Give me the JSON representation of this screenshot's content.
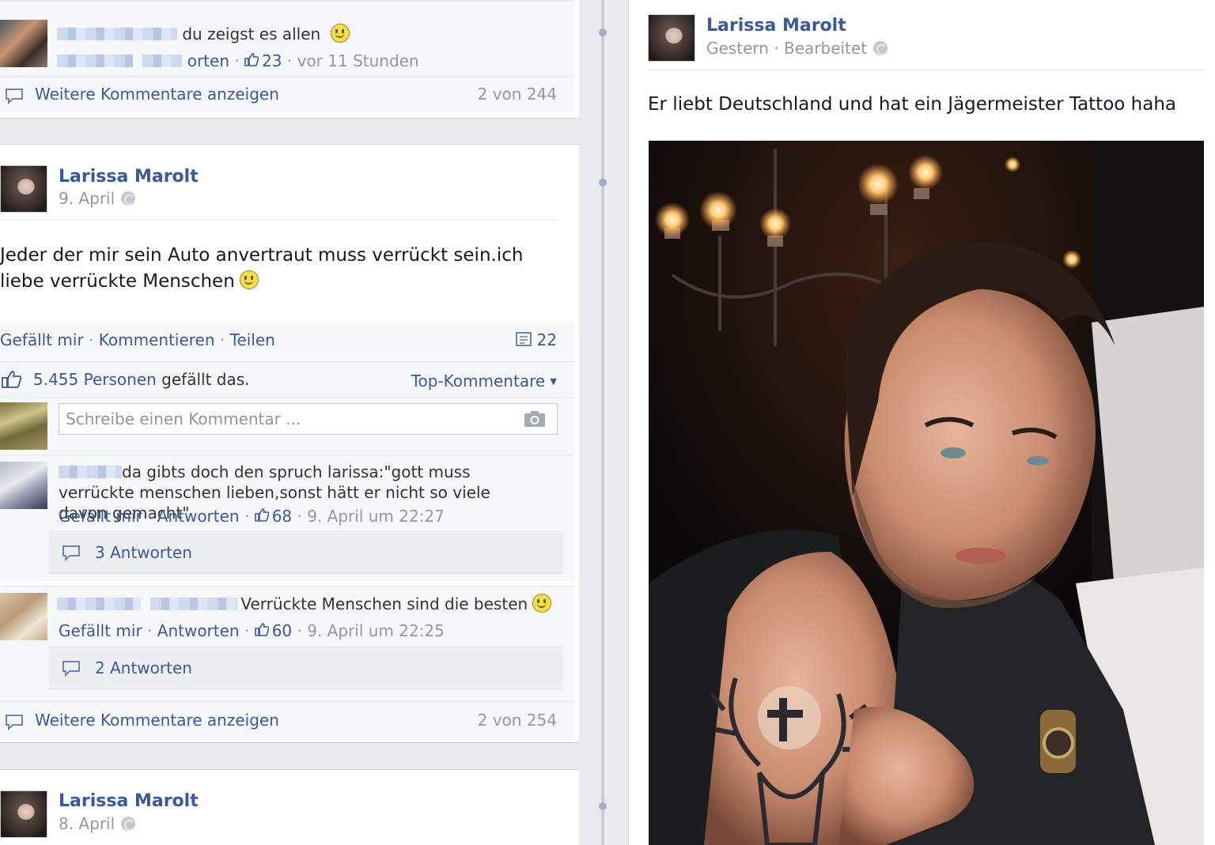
{
  "left": {
    "top_block": {
      "comment_text": "du zeigst es allen",
      "partial_action": "orten",
      "likes": "23",
      "time": "vor 11 Stunden",
      "more_comments": "Weitere Kommentare anzeigen",
      "more_count": "2 von 244"
    },
    "post": {
      "author": "Larissa Marolt",
      "date": "9. April",
      "text": "Jeder der mir sein Auto anvertraut muss verrückt sein.ich liebe verrückte Menschen",
      "actions": {
        "like": "Gefällt mir",
        "comment": "Kommentieren",
        "share": "Teilen"
      },
      "shares_count": "22",
      "likes_count": "5.455 Personen",
      "likes_suffix": "gefällt das.",
      "top_comments": "Top-Kommentare",
      "comment_placeholder": "Schreibe einen Kommentar ...",
      "comments": [
        {
          "text": "da gibts doch den spruch larissa:\"gott muss verrückte menschen lieben,sonst hätt er nicht so viele davon gemacht\"",
          "like_label": "Gefällt mir",
          "reply_label": "Antworten",
          "likes": "68",
          "time": "9. April um 22:27",
          "replies": "3 Antworten"
        },
        {
          "text": "Verrückte Menschen sind die besten",
          "like_label": "Gefällt mir",
          "reply_label": "Antworten",
          "likes": "60",
          "time": "9. April um 22:25",
          "replies": "2 Antworten"
        }
      ],
      "more_comments": "Weitere Kommentare anzeigen",
      "more_count": "2 von 254"
    },
    "next_post": {
      "author": "Larissa Marolt",
      "date": "8. April"
    }
  },
  "right": {
    "author": "Larissa Marolt",
    "date": "Gestern",
    "edited": "Bearbeitet",
    "text": "Er liebt Deutschland und hat ein Jägermeister Tattoo haha"
  },
  "colors": {
    "link": "#3b5998",
    "muted": "#9197a3",
    "page_bg": "#e9eaed",
    "action_bar_bg": "#f6f7f9"
  },
  "icons": [
    "smiley-icon",
    "thumbs-up-icon",
    "globe-icon",
    "comment-bubble-icon",
    "camera-icon",
    "share-count-icon",
    "chevron-down-icon"
  ]
}
